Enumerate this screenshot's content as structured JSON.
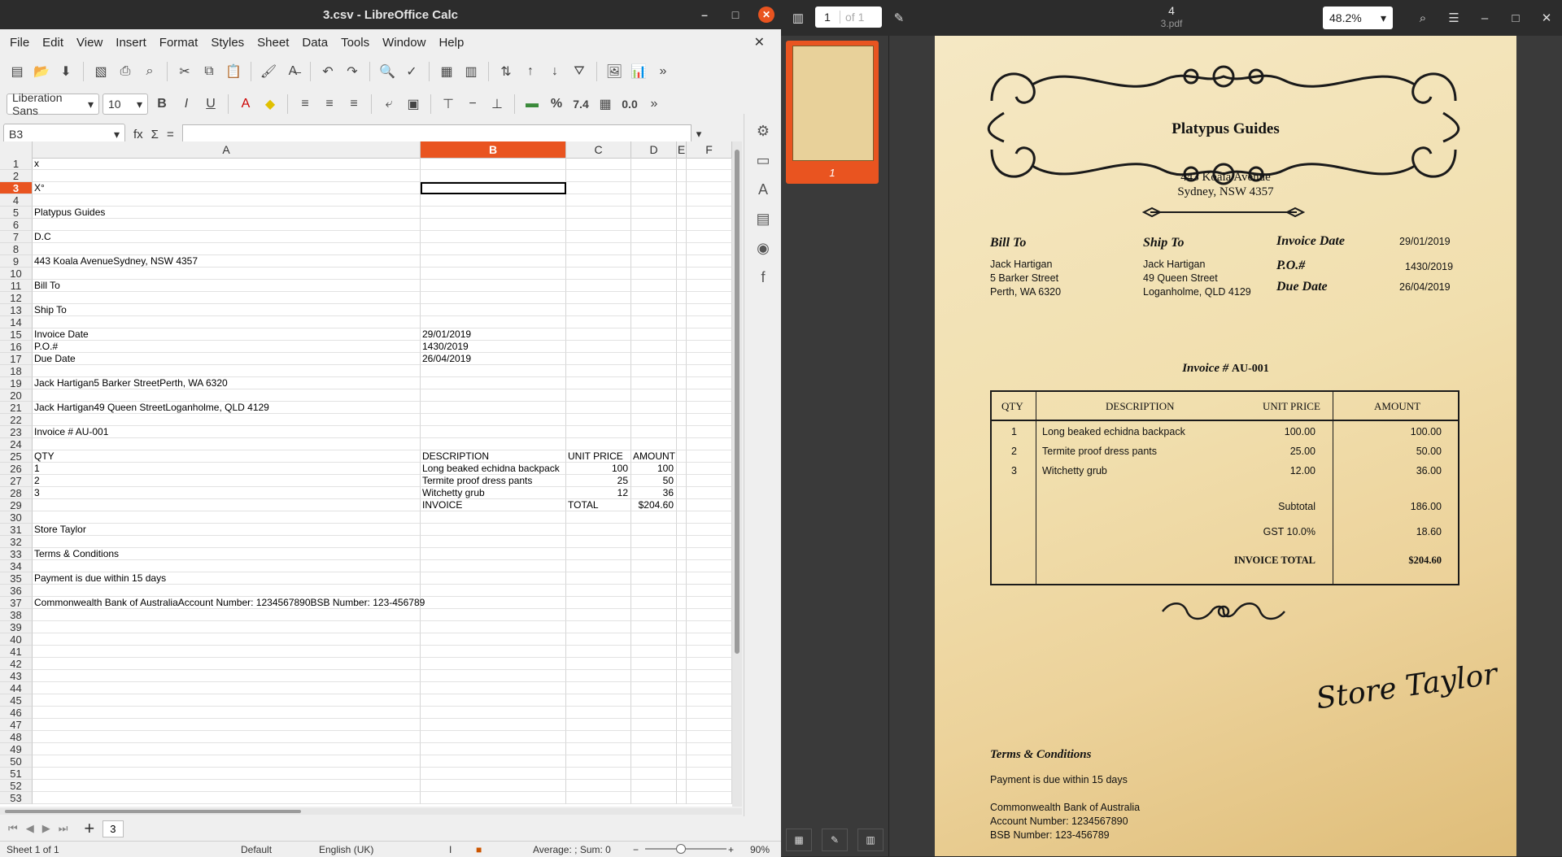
{
  "calc": {
    "title": "3.csv - LibreOffice Calc",
    "window_buttons": {
      "minimize": "–",
      "maximize": "□",
      "close": "✕"
    },
    "menu": [
      "File",
      "Edit",
      "View",
      "Insert",
      "Format",
      "Styles",
      "Sheet",
      "Data",
      "Tools",
      "Window",
      "Help"
    ],
    "doc_close": "✕",
    "font_name": "Liberation Sans",
    "font_size": "10",
    "toolbar_text": {
      "bold": "B",
      "italic": "I",
      "underline": "U",
      "percent": "%",
      "number": "7.4",
      "zeros": "0.0"
    },
    "name_box": "B3",
    "fx_icons": {
      "fx": "fx",
      "sigma": "Σ",
      "equals": "="
    },
    "columns": [
      "A",
      "B",
      "C",
      "D",
      "E",
      "F"
    ],
    "selected_column": "B",
    "selected_row": "3",
    "rows": [
      {
        "n": "1",
        "a": "x",
        "b": "",
        "c": "",
        "d": ""
      },
      {
        "n": "2",
        "a": "",
        "b": "",
        "c": "",
        "d": ""
      },
      {
        "n": "3",
        "a": "X°",
        "b": "",
        "c": "",
        "d": ""
      },
      {
        "n": "4",
        "a": "",
        "b": "",
        "c": "",
        "d": ""
      },
      {
        "n": "5",
        "a": "Platypus Guides",
        "b": "",
        "c": "",
        "d": ""
      },
      {
        "n": "6",
        "a": "",
        "b": "",
        "c": "",
        "d": ""
      },
      {
        "n": "7",
        "a": "D.C",
        "b": "",
        "c": "",
        "d": ""
      },
      {
        "n": "8",
        "a": "",
        "b": "",
        "c": "",
        "d": ""
      },
      {
        "n": "9",
        "a": "443 Koala AvenueSydney, NSW 4357",
        "b": "",
        "c": "",
        "d": ""
      },
      {
        "n": "10",
        "a": "",
        "b": "",
        "c": "",
        "d": ""
      },
      {
        "n": "11",
        "a": "Bill To",
        "b": "",
        "c": "",
        "d": ""
      },
      {
        "n": "12",
        "a": "",
        "b": "",
        "c": "",
        "d": ""
      },
      {
        "n": "13",
        "a": "Ship To",
        "b": "",
        "c": "",
        "d": ""
      },
      {
        "n": "14",
        "a": "",
        "b": "",
        "c": "",
        "d": ""
      },
      {
        "n": "15",
        "a": "Invoice Date",
        "b": "29/01/2019",
        "c": "",
        "d": ""
      },
      {
        "n": "16",
        "a": "P.O.#",
        "b": "1430/2019",
        "c": "",
        "d": ""
      },
      {
        "n": "17",
        "a": "Due Date",
        "b": "26/04/2019",
        "c": "",
        "d": ""
      },
      {
        "n": "18",
        "a": "",
        "b": "",
        "c": "",
        "d": ""
      },
      {
        "n": "19",
        "a": "Jack Hartigan5 Barker StreetPerth, WA 6320",
        "b": "",
        "c": "",
        "d": ""
      },
      {
        "n": "20",
        "a": "",
        "b": "",
        "c": "",
        "d": ""
      },
      {
        "n": "21",
        "a": "Jack Hartigan49 Queen StreetLoganholme, QLD 4129",
        "b": "",
        "c": "",
        "d": ""
      },
      {
        "n": "22",
        "a": "",
        "b": "",
        "c": "",
        "d": ""
      },
      {
        "n": "23",
        "a": "Invoice # AU-001",
        "b": "",
        "c": "",
        "d": ""
      },
      {
        "n": "24",
        "a": "",
        "b": "",
        "c": "",
        "d": ""
      },
      {
        "n": "25",
        "a": "QTY",
        "b": "DESCRIPTION",
        "c": "UNIT PRICE",
        "d": "AMOUNT"
      },
      {
        "n": "26",
        "a": "1",
        "b": "Long beaked echidna backpack",
        "c": "100",
        "d": "100"
      },
      {
        "n": "27",
        "a": "2",
        "b": "Termite proof dress pants",
        "c": "25",
        "d": "50"
      },
      {
        "n": "28",
        "a": "3",
        "b": "Witchetty grub",
        "c": "12",
        "d": "36"
      },
      {
        "n": "29",
        "a": "",
        "b": "INVOICE",
        "c": "TOTAL",
        "d": "$204.60"
      },
      {
        "n": "30",
        "a": "",
        "b": "",
        "c": "",
        "d": ""
      },
      {
        "n": "31",
        "a": "Store Taylor",
        "b": "",
        "c": "",
        "d": ""
      },
      {
        "n": "32",
        "a": "",
        "b": "",
        "c": "",
        "d": ""
      },
      {
        "n": "33",
        "a": "Terms & Conditions",
        "b": "",
        "c": "",
        "d": ""
      },
      {
        "n": "34",
        "a": "",
        "b": "",
        "c": "",
        "d": ""
      },
      {
        "n": "35",
        "a": "Payment is due within 15 days",
        "b": "",
        "c": "",
        "d": ""
      },
      {
        "n": "36",
        "a": "",
        "b": "",
        "c": "",
        "d": ""
      },
      {
        "n": "37",
        "a": "Commonwealth Bank of AustraliaAccount Number: 1234567890BSB Number: 123-456789",
        "b": "",
        "c": "",
        "d": ""
      },
      {
        "n": "38",
        "a": "",
        "b": "",
        "c": "",
        "d": ""
      },
      {
        "n": "39",
        "a": "",
        "b": "",
        "c": "",
        "d": ""
      },
      {
        "n": "40",
        "a": "",
        "b": "",
        "c": "",
        "d": ""
      },
      {
        "n": "41",
        "a": "",
        "b": "",
        "c": "",
        "d": ""
      },
      {
        "n": "42",
        "a": "",
        "b": "",
        "c": "",
        "d": ""
      },
      {
        "n": "43",
        "a": "",
        "b": "",
        "c": "",
        "d": ""
      },
      {
        "n": "44",
        "a": "",
        "b": "",
        "c": "",
        "d": ""
      },
      {
        "n": "45",
        "a": "",
        "b": "",
        "c": "",
        "d": ""
      },
      {
        "n": "46",
        "a": "",
        "b": "",
        "c": "",
        "d": ""
      },
      {
        "n": "47",
        "a": "",
        "b": "",
        "c": "",
        "d": ""
      },
      {
        "n": "48",
        "a": "",
        "b": "",
        "c": "",
        "d": ""
      },
      {
        "n": "49",
        "a": "",
        "b": "",
        "c": "",
        "d": ""
      },
      {
        "n": "50",
        "a": "",
        "b": "",
        "c": "",
        "d": ""
      },
      {
        "n": "51",
        "a": "",
        "b": "",
        "c": "",
        "d": ""
      },
      {
        "n": "52",
        "a": "",
        "b": "",
        "c": "",
        "d": ""
      },
      {
        "n": "53",
        "a": "",
        "b": "",
        "c": "",
        "d": ""
      }
    ],
    "sheet_tab": "3",
    "status": {
      "sheet": "Sheet 1 of 1",
      "style": "Default",
      "language": "English (UK)",
      "summary": "Average: ; Sum: 0",
      "zoom": "90%"
    }
  },
  "pdf": {
    "title": "4",
    "subtitle": "3.pdf",
    "page_current": "1",
    "page_of": "of 1",
    "zoom": "48.2%",
    "thumb_label": "1",
    "invoice": {
      "company": "Platypus Guides",
      "address_line1": "443 Koala Avenue",
      "address_line2": "Sydney, NSW 4357",
      "bill_to_label": "Bill To",
      "bill_to": [
        "Jack Hartigan",
        "5 Barker Street",
        "Perth, WA 6320"
      ],
      "ship_to_label": "Ship To",
      "ship_to": [
        "Jack Hartigan",
        "49 Queen Street",
        "Loganholme, QLD 4129"
      ],
      "invoice_date_label": "Invoice Date",
      "invoice_date": "29/01/2019",
      "po_label": "P.O.#",
      "po": "1430/2019",
      "due_date_label": "Due Date",
      "due_date": "26/04/2019",
      "invoice_number_label": "Invoice #",
      "invoice_number": "AU-001",
      "table_headers": {
        "qty": "QTY",
        "description": "DESCRIPTION",
        "unit_price": "UNIT PRICE",
        "amount": "AMOUNT"
      },
      "items": [
        {
          "qty": "1",
          "description": "Long beaked echidna backpack",
          "unit_price": "100.00",
          "amount": "100.00"
        },
        {
          "qty": "2",
          "description": "Termite proof dress pants",
          "unit_price": "25.00",
          "amount": "50.00"
        },
        {
          "qty": "3",
          "description": "Witchetty grub",
          "unit_price": "12.00",
          "amount": "36.00"
        }
      ],
      "subtotal_label": "Subtotal",
      "subtotal": "186.00",
      "gst_label": "GST 10.0%",
      "gst": "18.60",
      "total_label": "INVOICE TOTAL",
      "total": "$204.60",
      "signature": "Store Taylor",
      "terms_label": "Terms & Conditions",
      "terms_text": "Payment is due within 15 days",
      "bank_lines": [
        "Commonwealth Bank of Australia",
        "Account Number: 1234567890",
        "BSB Number: 123-456789"
      ]
    }
  }
}
